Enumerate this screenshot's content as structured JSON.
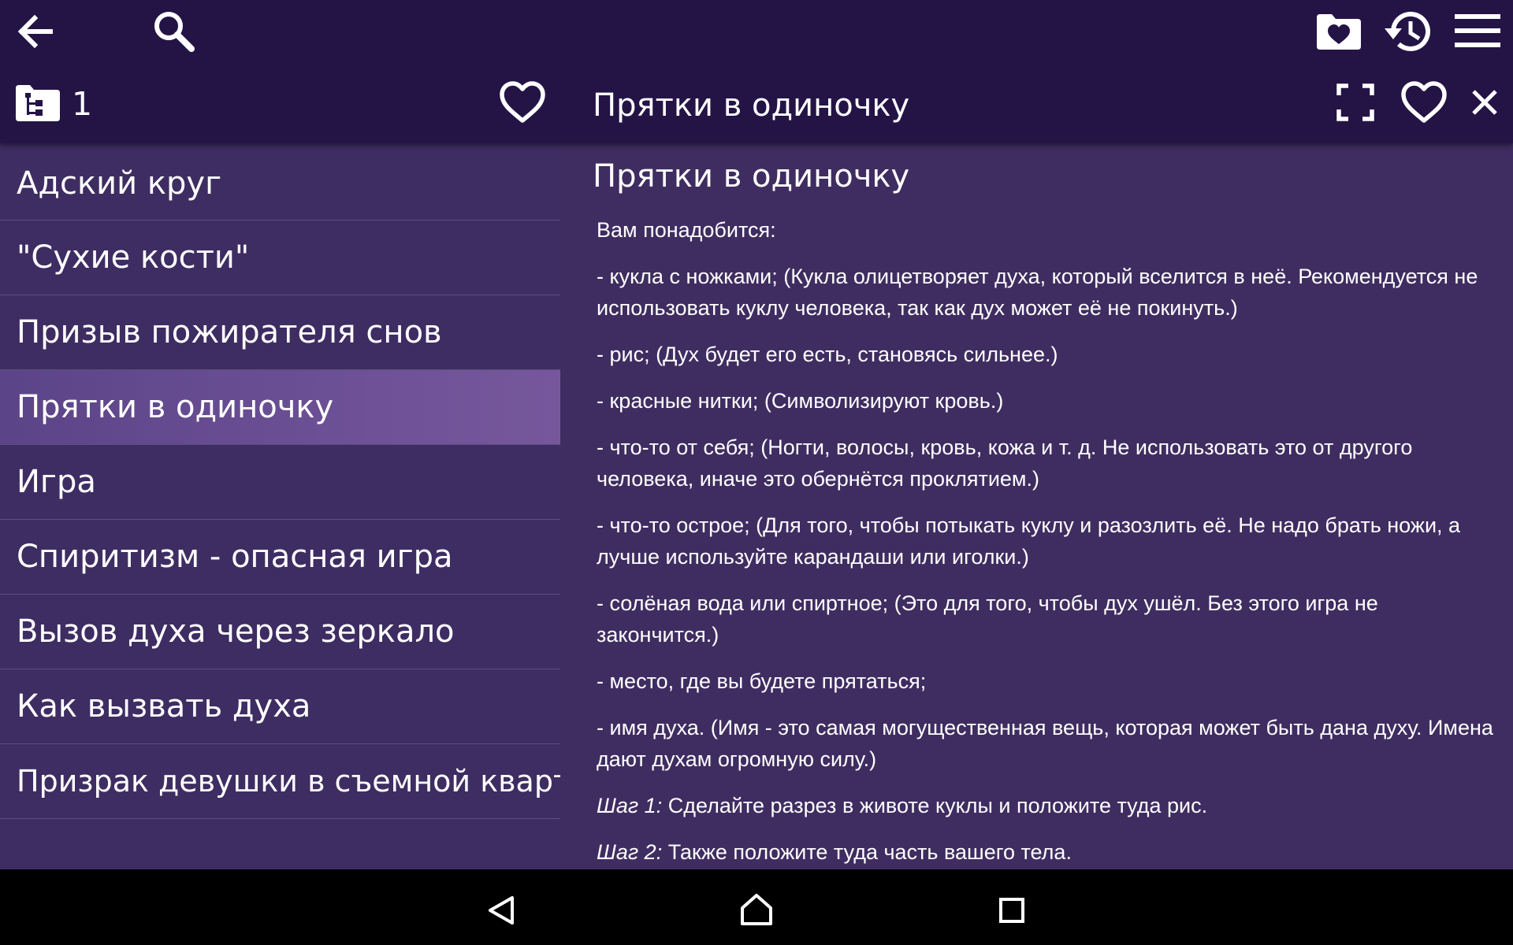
{
  "toolbar": {
    "back_icon": "arrow-left-icon",
    "search_icon": "search-icon",
    "favorites_folder_icon": "folder-heart-icon",
    "history_icon": "history-icon",
    "menu_icon": "hamburger-menu-icon"
  },
  "list_header": {
    "category_icon": "folder-tree-icon",
    "count": "1",
    "favorite_icon": "heart-outline-icon"
  },
  "detail_header": {
    "title": "Прятки в одиночку",
    "fullscreen_icon": "fullscreen-icon",
    "favorite_icon": "heart-outline-icon",
    "close_icon": "close-icon"
  },
  "list": {
    "selected_index": 3,
    "items": [
      {
        "label": "Адский круг"
      },
      {
        "label": "\"Сухие кости\""
      },
      {
        "label": "Призыв пожирателя снов"
      },
      {
        "label": "Прятки в одиночку"
      },
      {
        "label": "Игра"
      },
      {
        "label": "Спиритизм - опасная игра"
      },
      {
        "label": "Вызов духа через зеркало"
      },
      {
        "label": "Как вызвать духа"
      },
      {
        "label": "Призрак девушки в съемной квартире"
      }
    ]
  },
  "article": {
    "title": "Прятки в одиночку",
    "paragraphs": [
      "Вам понадобится:",
      "- кукла с ножками; (Кукла олицетворяет духа, который вселится в неё. Рекомендуется не использовать куклу человека, так как дух может её не покинуть.)",
      "- рис; (Дух будет его есть, становясь сильнее.)",
      "- красные нитки; (Символизируют кровь.)",
      "- что-то от себя; (Ногти, волосы, кровь, кожа и т. д. Не использовать это от другого человека, иначе это обернётся проклятием.)",
      "- что-то острое; (Для того, чтобы потыкать куклу и разозлить её. Не надо брать ножи, а лучше используйте карандаши или иголки.)",
      "- солёная вода или спиртное; (Это для того, чтобы дух ушёл. Без этого игра не закончится.)",
      "- место, где вы будете прятаться;",
      "- имя духа. (Имя - это самая могущественная вещь, которая может быть дана духу. Имена дают духам огромную силу.)"
    ],
    "steps": [
      {
        "label": "Шаг 1:",
        "text": " Сделайте разрез в животе куклы и положите туда рис."
      },
      {
        "label": "Шаг 2:",
        "text": " Также положите туда часть вашего тела."
      }
    ]
  },
  "navbar": {
    "back_icon": "nav-back-triangle-icon",
    "home_icon": "nav-home-icon",
    "recents_icon": "nav-recents-square-icon"
  },
  "colors": {
    "topbar": "#241446",
    "background": "#402f62",
    "selected_item": "#6b4f95",
    "divider": "#5d4e80",
    "navbar": "#000000"
  }
}
